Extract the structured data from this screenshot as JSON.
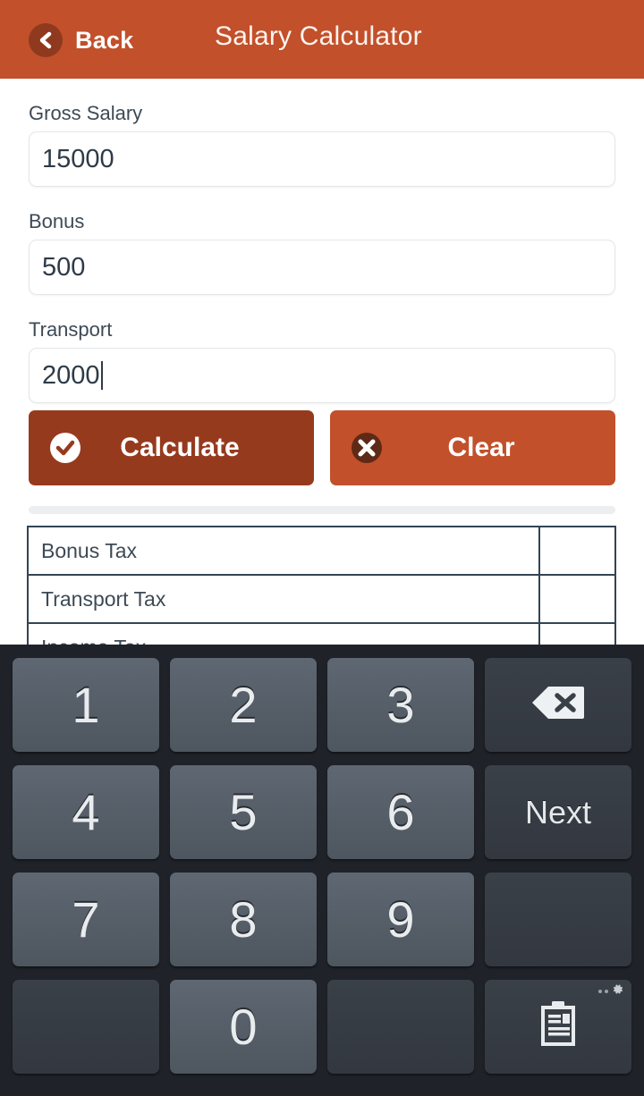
{
  "header": {
    "back_label": "Back",
    "back_icon": "chevron-left-icon",
    "title": "Salary Calculator",
    "bg_color": "#c2502b",
    "back_circle_color": "#8f3a1f"
  },
  "form": {
    "fields": [
      {
        "label": "Gross Salary",
        "value": "15000",
        "placeholder": "",
        "focused": false
      },
      {
        "label": "Bonus",
        "value": "500",
        "placeholder": "",
        "focused": false
      },
      {
        "label": "Transport",
        "value": "2000",
        "placeholder": "",
        "focused": true
      }
    ]
  },
  "actions": {
    "calculate": {
      "label": "Calculate",
      "icon": "check-circle-icon",
      "color": "#963a1e"
    },
    "clear": {
      "label": "Clear",
      "icon": "x-circle-icon",
      "color": "#c2502b"
    }
  },
  "results": {
    "rows": [
      {
        "name": "Bonus Tax",
        "value": ""
      },
      {
        "name": "Transport Tax",
        "value": ""
      },
      {
        "name": "Income Tax",
        "value": ""
      }
    ]
  },
  "keyboard": {
    "rows": [
      [
        {
          "label": "1",
          "type": "num",
          "name": "key-1"
        },
        {
          "label": "2",
          "type": "num",
          "name": "key-2"
        },
        {
          "label": "3",
          "type": "num",
          "name": "key-3"
        },
        {
          "label": "",
          "type": "fn",
          "name": "backspace-key",
          "icon": "backspace-icon"
        }
      ],
      [
        {
          "label": "4",
          "type": "num",
          "name": "key-4"
        },
        {
          "label": "5",
          "type": "num",
          "name": "key-5"
        },
        {
          "label": "6",
          "type": "num",
          "name": "key-6"
        },
        {
          "label": "Next",
          "type": "fn",
          "name": "next-key"
        }
      ],
      [
        {
          "label": "7",
          "type": "num",
          "name": "key-7"
        },
        {
          "label": "8",
          "type": "num",
          "name": "key-8"
        },
        {
          "label": "9",
          "type": "num",
          "name": "key-9"
        },
        {
          "label": "",
          "type": "blank",
          "name": "blank-key"
        }
      ],
      [
        {
          "label": "",
          "type": "blank",
          "name": "blank-key"
        },
        {
          "label": "0",
          "type": "num",
          "name": "key-0"
        },
        {
          "label": "",
          "type": "blank",
          "name": "blank-key"
        },
        {
          "label": "",
          "type": "fn",
          "name": "clipboard-key",
          "icon": "clipboard-icon"
        }
      ]
    ],
    "bg_color": "#1f2329",
    "num_key_color": "#56606a",
    "fn_key_color": "#373d45"
  }
}
